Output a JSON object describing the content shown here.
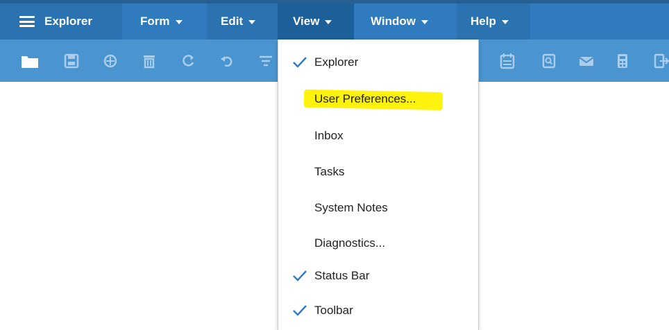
{
  "menubar": {
    "items": [
      {
        "label": "Explorer",
        "icon": "hamburger-menu-icon"
      },
      {
        "label": "Form"
      },
      {
        "label": "Edit"
      },
      {
        "label": "View"
      },
      {
        "label": "Window"
      },
      {
        "label": "Help"
      }
    ],
    "colors": {
      "bar": "#2f7bbd",
      "active": "#1c5f99",
      "toolbar": "#4a95d0"
    }
  },
  "toolbar": {
    "icons": [
      "open-folder-icon",
      "save-icon",
      "target-icon",
      "delete-icon",
      "refresh-icon",
      "undo-icon",
      "filter-icon",
      "calendar-icon",
      "document-search-icon",
      "mail-icon",
      "calculator-icon",
      "exit-icon"
    ]
  },
  "view_menu": {
    "items": [
      {
        "label": "Explorer",
        "checked": true
      },
      {
        "label": "User Preferences...",
        "checked": false,
        "highlighted": true
      },
      {
        "label": "Inbox",
        "checked": false
      },
      {
        "label": "Tasks",
        "checked": false
      },
      {
        "label": "System Notes",
        "checked": false
      },
      {
        "label": "Diagnostics...",
        "checked": false
      },
      {
        "label": "Status Bar",
        "checked": true
      },
      {
        "label": "Toolbar",
        "checked": true
      }
    ],
    "check_color": "#2f7bbd",
    "highlight_color": "#fff200"
  }
}
